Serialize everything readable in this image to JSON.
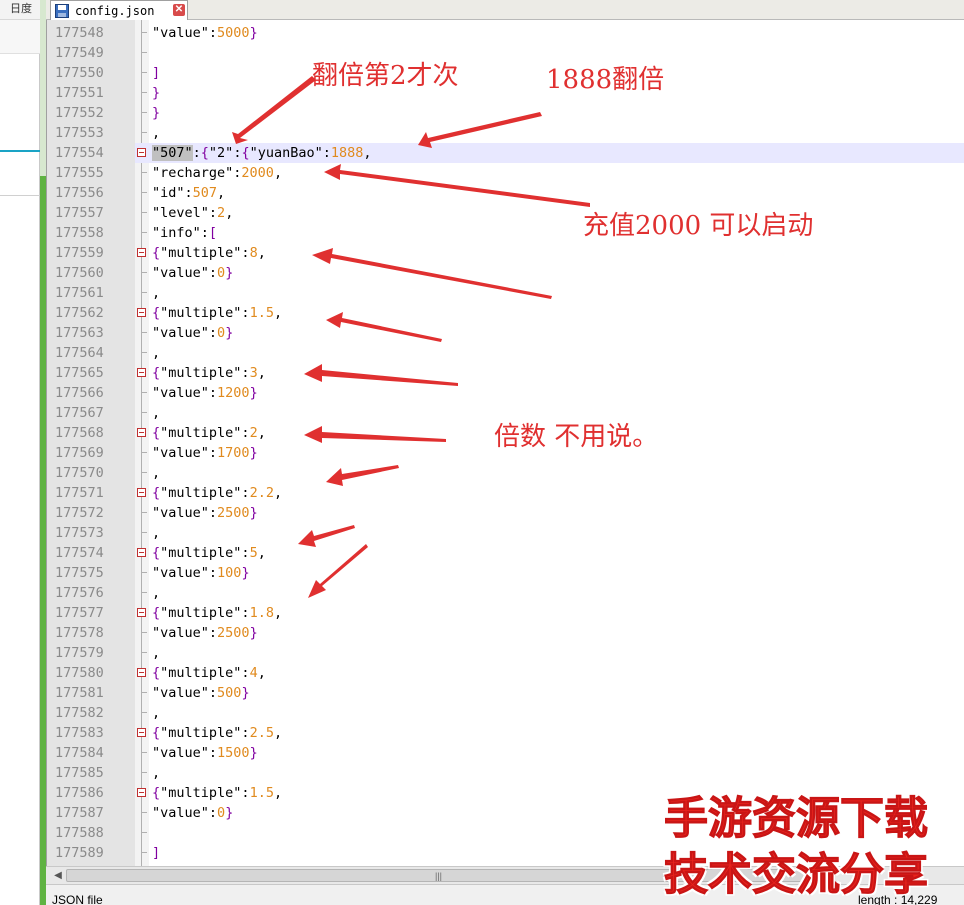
{
  "left_window": {
    "title_fragment": "日度"
  },
  "editor": {
    "tab_label": "config.json",
    "lines": [
      {
        "n": "177548",
        "code": [
          {
            "t": "\"value\"",
            "c": "k"
          },
          {
            "t": ":",
            "c": "k"
          },
          {
            "t": "5000",
            "c": "n"
          },
          {
            "t": "}",
            "c": "p"
          }
        ]
      },
      {
        "n": "177549",
        "code": []
      },
      {
        "n": "177550",
        "code": [
          {
            "t": "]",
            "c": "p"
          }
        ]
      },
      {
        "n": "177551",
        "code": [
          {
            "t": "}",
            "c": "p"
          }
        ]
      },
      {
        "n": "177552",
        "code": [
          {
            "t": "}",
            "c": "p"
          }
        ]
      },
      {
        "n": "177553",
        "code": [
          {
            "t": ",",
            "c": "k"
          }
        ]
      },
      {
        "n": "177554",
        "fold": true,
        "code": [
          {
            "t": "\"507\"",
            "c": "sel"
          },
          {
            "t": ":",
            "c": "k"
          },
          {
            "t": "{",
            "c": "p"
          },
          {
            "t": "\"2\"",
            "c": "k"
          },
          {
            "t": ":",
            "c": "k"
          },
          {
            "t": "{",
            "c": "p"
          },
          {
            "t": "\"yuanBao\"",
            "c": "k"
          },
          {
            "t": ":",
            "c": "k"
          },
          {
            "t": "1888",
            "c": "n"
          },
          {
            "t": ",",
            "c": "k"
          }
        ]
      },
      {
        "n": "177555",
        "code": [
          {
            "t": "\"recharge\"",
            "c": "k"
          },
          {
            "t": ":",
            "c": "k"
          },
          {
            "t": "2000",
            "c": "n"
          },
          {
            "t": ",",
            "c": "k"
          }
        ]
      },
      {
        "n": "177556",
        "code": [
          {
            "t": "\"id\"",
            "c": "k"
          },
          {
            "t": ":",
            "c": "k"
          },
          {
            "t": "507",
            "c": "n"
          },
          {
            "t": ",",
            "c": "k"
          }
        ]
      },
      {
        "n": "177557",
        "code": [
          {
            "t": "\"level\"",
            "c": "k"
          },
          {
            "t": ":",
            "c": "k"
          },
          {
            "t": "2",
            "c": "n"
          },
          {
            "t": ",",
            "c": "k"
          }
        ]
      },
      {
        "n": "177558",
        "code": [
          {
            "t": "\"info\"",
            "c": "k"
          },
          {
            "t": ":",
            "c": "k"
          },
          {
            "t": "[",
            "c": "p"
          }
        ]
      },
      {
        "n": "177559",
        "fold": true,
        "code": [
          {
            "t": "{",
            "c": "p"
          },
          {
            "t": "\"multiple\"",
            "c": "k"
          },
          {
            "t": ":",
            "c": "k"
          },
          {
            "t": "8",
            "c": "n"
          },
          {
            "t": ",",
            "c": "k"
          }
        ]
      },
      {
        "n": "177560",
        "code": [
          {
            "t": "\"value\"",
            "c": "k"
          },
          {
            "t": ":",
            "c": "k"
          },
          {
            "t": "0",
            "c": "n"
          },
          {
            "t": "}",
            "c": "p"
          }
        ]
      },
      {
        "n": "177561",
        "code": [
          {
            "t": ",",
            "c": "k"
          }
        ]
      },
      {
        "n": "177562",
        "fold": true,
        "code": [
          {
            "t": "{",
            "c": "p"
          },
          {
            "t": "\"multiple\"",
            "c": "k"
          },
          {
            "t": ":",
            "c": "k"
          },
          {
            "t": "1.5",
            "c": "n"
          },
          {
            "t": ",",
            "c": "k"
          }
        ]
      },
      {
        "n": "177563",
        "code": [
          {
            "t": "\"value\"",
            "c": "k"
          },
          {
            "t": ":",
            "c": "k"
          },
          {
            "t": "0",
            "c": "n"
          },
          {
            "t": "}",
            "c": "p"
          }
        ]
      },
      {
        "n": "177564",
        "code": [
          {
            "t": ",",
            "c": "k"
          }
        ]
      },
      {
        "n": "177565",
        "fold": true,
        "code": [
          {
            "t": "{",
            "c": "p"
          },
          {
            "t": "\"multiple\"",
            "c": "k"
          },
          {
            "t": ":",
            "c": "k"
          },
          {
            "t": "3",
            "c": "n"
          },
          {
            "t": ",",
            "c": "k"
          }
        ]
      },
      {
        "n": "177566",
        "code": [
          {
            "t": "\"value\"",
            "c": "k"
          },
          {
            "t": ":",
            "c": "k"
          },
          {
            "t": "1200",
            "c": "n"
          },
          {
            "t": "}",
            "c": "p"
          }
        ]
      },
      {
        "n": "177567",
        "code": [
          {
            "t": ",",
            "c": "k"
          }
        ]
      },
      {
        "n": "177568",
        "fold": true,
        "code": [
          {
            "t": "{",
            "c": "p"
          },
          {
            "t": "\"multiple\"",
            "c": "k"
          },
          {
            "t": ":",
            "c": "k"
          },
          {
            "t": "2",
            "c": "n"
          },
          {
            "t": ",",
            "c": "k"
          }
        ]
      },
      {
        "n": "177569",
        "code": [
          {
            "t": "\"value\"",
            "c": "k"
          },
          {
            "t": ":",
            "c": "k"
          },
          {
            "t": "1700",
            "c": "n"
          },
          {
            "t": "}",
            "c": "p"
          }
        ]
      },
      {
        "n": "177570",
        "code": [
          {
            "t": ",",
            "c": "k"
          }
        ]
      },
      {
        "n": "177571",
        "fold": true,
        "code": [
          {
            "t": "{",
            "c": "p"
          },
          {
            "t": "\"multiple\"",
            "c": "k"
          },
          {
            "t": ":",
            "c": "k"
          },
          {
            "t": "2.2",
            "c": "n"
          },
          {
            "t": ",",
            "c": "k"
          }
        ]
      },
      {
        "n": "177572",
        "code": [
          {
            "t": "\"value\"",
            "c": "k"
          },
          {
            "t": ":",
            "c": "k"
          },
          {
            "t": "2500",
            "c": "n"
          },
          {
            "t": "}",
            "c": "p"
          }
        ]
      },
      {
        "n": "177573",
        "code": [
          {
            "t": ",",
            "c": "k"
          }
        ]
      },
      {
        "n": "177574",
        "fold": true,
        "code": [
          {
            "t": "{",
            "c": "p"
          },
          {
            "t": "\"multiple\"",
            "c": "k"
          },
          {
            "t": ":",
            "c": "k"
          },
          {
            "t": "5",
            "c": "n"
          },
          {
            "t": ",",
            "c": "k"
          }
        ]
      },
      {
        "n": "177575",
        "code": [
          {
            "t": "\"value\"",
            "c": "k"
          },
          {
            "t": ":",
            "c": "k"
          },
          {
            "t": "100",
            "c": "n"
          },
          {
            "t": "}",
            "c": "p"
          }
        ]
      },
      {
        "n": "177576",
        "code": [
          {
            "t": ",",
            "c": "k"
          }
        ]
      },
      {
        "n": "177577",
        "fold": true,
        "code": [
          {
            "t": "{",
            "c": "p"
          },
          {
            "t": "\"multiple\"",
            "c": "k"
          },
          {
            "t": ":",
            "c": "k"
          },
          {
            "t": "1.8",
            "c": "n"
          },
          {
            "t": ",",
            "c": "k"
          }
        ]
      },
      {
        "n": "177578",
        "code": [
          {
            "t": "\"value\"",
            "c": "k"
          },
          {
            "t": ":",
            "c": "k"
          },
          {
            "t": "2500",
            "c": "n"
          },
          {
            "t": "}",
            "c": "p"
          }
        ]
      },
      {
        "n": "177579",
        "code": [
          {
            "t": ",",
            "c": "k"
          }
        ]
      },
      {
        "n": "177580",
        "fold": true,
        "code": [
          {
            "t": "{",
            "c": "p"
          },
          {
            "t": "\"multiple\"",
            "c": "k"
          },
          {
            "t": ":",
            "c": "k"
          },
          {
            "t": "4",
            "c": "n"
          },
          {
            "t": ",",
            "c": "k"
          }
        ]
      },
      {
        "n": "177581",
        "code": [
          {
            "t": "\"value\"",
            "c": "k"
          },
          {
            "t": ":",
            "c": "k"
          },
          {
            "t": "500",
            "c": "n"
          },
          {
            "t": "}",
            "c": "p"
          }
        ]
      },
      {
        "n": "177582",
        "code": [
          {
            "t": ",",
            "c": "k"
          }
        ]
      },
      {
        "n": "177583",
        "fold": true,
        "code": [
          {
            "t": "{",
            "c": "p"
          },
          {
            "t": "\"multiple\"",
            "c": "k"
          },
          {
            "t": ":",
            "c": "k"
          },
          {
            "t": "2.5",
            "c": "n"
          },
          {
            "t": ",",
            "c": "k"
          }
        ]
      },
      {
        "n": "177584",
        "code": [
          {
            "t": "\"value\"",
            "c": "k"
          },
          {
            "t": ":",
            "c": "k"
          },
          {
            "t": "1500",
            "c": "n"
          },
          {
            "t": "}",
            "c": "p"
          }
        ]
      },
      {
        "n": "177585",
        "code": [
          {
            "t": ",",
            "c": "k"
          }
        ]
      },
      {
        "n": "177586",
        "fold": true,
        "code": [
          {
            "t": "{",
            "c": "p"
          },
          {
            "t": "\"multiple\"",
            "c": "k"
          },
          {
            "t": ":",
            "c": "k"
          },
          {
            "t": "1.5",
            "c": "n"
          },
          {
            "t": ",",
            "c": "k"
          }
        ]
      },
      {
        "n": "177587",
        "code": [
          {
            "t": "\"value\"",
            "c": "k"
          },
          {
            "t": ":",
            "c": "k"
          },
          {
            "t": "0",
            "c": "n"
          },
          {
            "t": "}",
            "c": "p"
          }
        ]
      },
      {
        "n": "177588",
        "code": []
      },
      {
        "n": "177589",
        "code": [
          {
            "t": "]",
            "c": "p"
          }
        ]
      }
    ]
  },
  "status": {
    "file_type": "JSON file",
    "length": "length : 14,229"
  },
  "annotations": {
    "double_second": "翻倍第2才次",
    "double_1888": "1888翻倍",
    "recharge_2000": "充值2000 可以启动",
    "multiplier_note": "倍数 不用说。"
  },
  "watermark": {
    "line1": "手游资源下载",
    "line2": "技术交流分享"
  },
  "colors": {
    "annotation_red": "#e03030",
    "number_orange": "#e08a1e",
    "brace_purple": "#8000a0",
    "current_line": "#e8e8ff"
  }
}
